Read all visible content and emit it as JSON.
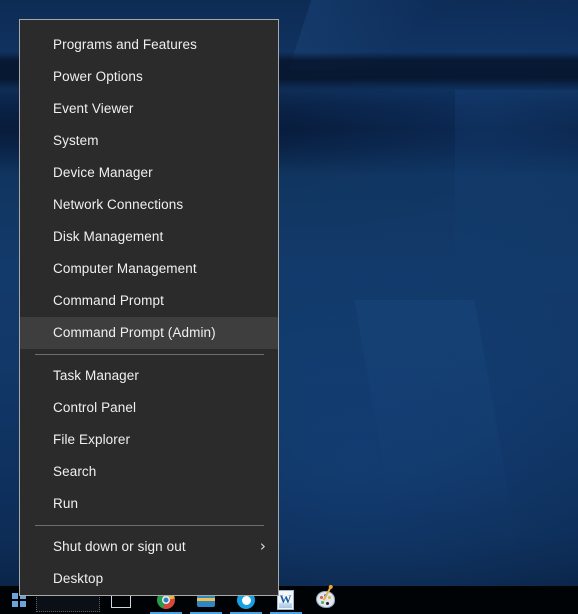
{
  "desktop": {
    "wallpaper_name": "windows-10-hero-blue",
    "colors": {
      "wallpaper_base": "#123a6a",
      "wallpaper_dark": "#081c3c",
      "taskbar": "#000306",
      "menu_background": "#2b2b2b",
      "menu_border": "#a8a8a8",
      "menu_highlight": "#3e3e3e",
      "menu_text": "#f0f0f0",
      "separator": "#6e6e6e",
      "start_logo": "#6ba4d8",
      "taskbar_accent": "#4aa3e0"
    }
  },
  "winx_menu": {
    "groups": [
      {
        "name": "admin-tools",
        "items": [
          {
            "label": "Programs and Features",
            "name": "menu-item-programs-and-features",
            "highlighted": false,
            "submenu": false
          },
          {
            "label": "Power Options",
            "name": "menu-item-power-options",
            "highlighted": false,
            "submenu": false
          },
          {
            "label": "Event Viewer",
            "name": "menu-item-event-viewer",
            "highlighted": false,
            "submenu": false
          },
          {
            "label": "System",
            "name": "menu-item-system",
            "highlighted": false,
            "submenu": false
          },
          {
            "label": "Device Manager",
            "name": "menu-item-device-manager",
            "highlighted": false,
            "submenu": false
          },
          {
            "label": "Network Connections",
            "name": "menu-item-network-connections",
            "highlighted": false,
            "submenu": false
          },
          {
            "label": "Disk Management",
            "name": "menu-item-disk-management",
            "highlighted": false,
            "submenu": false
          },
          {
            "label": "Computer Management",
            "name": "menu-item-computer-management",
            "highlighted": false,
            "submenu": false
          },
          {
            "label": "Command Prompt",
            "name": "menu-item-command-prompt",
            "highlighted": false,
            "submenu": false
          },
          {
            "label": "Command Prompt (Admin)",
            "name": "menu-item-command-prompt-admin",
            "highlighted": true,
            "submenu": false
          }
        ]
      },
      {
        "name": "system-tools",
        "items": [
          {
            "label": "Task Manager",
            "name": "menu-item-task-manager",
            "highlighted": false,
            "submenu": false
          },
          {
            "label": "Control Panel",
            "name": "menu-item-control-panel",
            "highlighted": false,
            "submenu": false
          },
          {
            "label": "File Explorer",
            "name": "menu-item-file-explorer",
            "highlighted": false,
            "submenu": false
          },
          {
            "label": "Search",
            "name": "menu-item-search",
            "highlighted": false,
            "submenu": false
          },
          {
            "label": "Run",
            "name": "menu-item-run",
            "highlighted": false,
            "submenu": false
          }
        ]
      },
      {
        "name": "session",
        "items": [
          {
            "label": "Shut down or sign out",
            "name": "menu-item-shut-down-or-sign-out",
            "highlighted": false,
            "submenu": true,
            "submenu_glyph": "›"
          },
          {
            "label": "Desktop",
            "name": "menu-item-desktop",
            "highlighted": false,
            "submenu": false
          }
        ]
      }
    ]
  },
  "taskbar": {
    "start_button": {
      "name": "start-button",
      "icon": "windows-logo-icon"
    },
    "search_box": {
      "name": "taskbar-search-box",
      "placeholder": ""
    },
    "task_view": {
      "name": "task-view-button",
      "icon": "task-view-icon"
    },
    "pinned_apps": [
      {
        "name": "taskbar-icon-chrome",
        "icon": "chrome-icon",
        "running": true
      },
      {
        "name": "taskbar-icon-store",
        "icon": "toolbox-icon",
        "running": true
      },
      {
        "name": "taskbar-icon-skype",
        "icon": "skype-icon",
        "running": true
      },
      {
        "name": "taskbar-icon-word",
        "icon": "word-icon",
        "running": true
      },
      {
        "name": "taskbar-icon-paint",
        "icon": "paint-icon",
        "running": false
      }
    ]
  }
}
